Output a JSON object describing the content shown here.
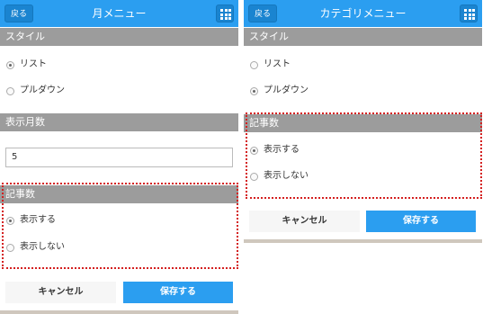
{
  "left": {
    "back_label": "戻る",
    "title": "月メニュー",
    "style_section": "スタイル",
    "style_options": [
      "リスト",
      "プルダウン"
    ],
    "months_section": "表示月数",
    "months_value": "5",
    "count_section": "記事数",
    "count_options": [
      "表示する",
      "表示しない"
    ],
    "cancel_label": "キャンセル",
    "save_label": "保存する"
  },
  "right": {
    "back_label": "戻る",
    "title": "カテゴリメニュー",
    "style_section": "スタイル",
    "style_options": [
      "リスト",
      "プルダウン"
    ],
    "count_section": "記事数",
    "count_options": [
      "表示する",
      "表示しない"
    ],
    "cancel_label": "キャンセル",
    "save_label": "保存する"
  },
  "colors": {
    "header": "#2b9ef0",
    "section_bar": "#9c9c9c",
    "highlight_border": "#d42020"
  }
}
